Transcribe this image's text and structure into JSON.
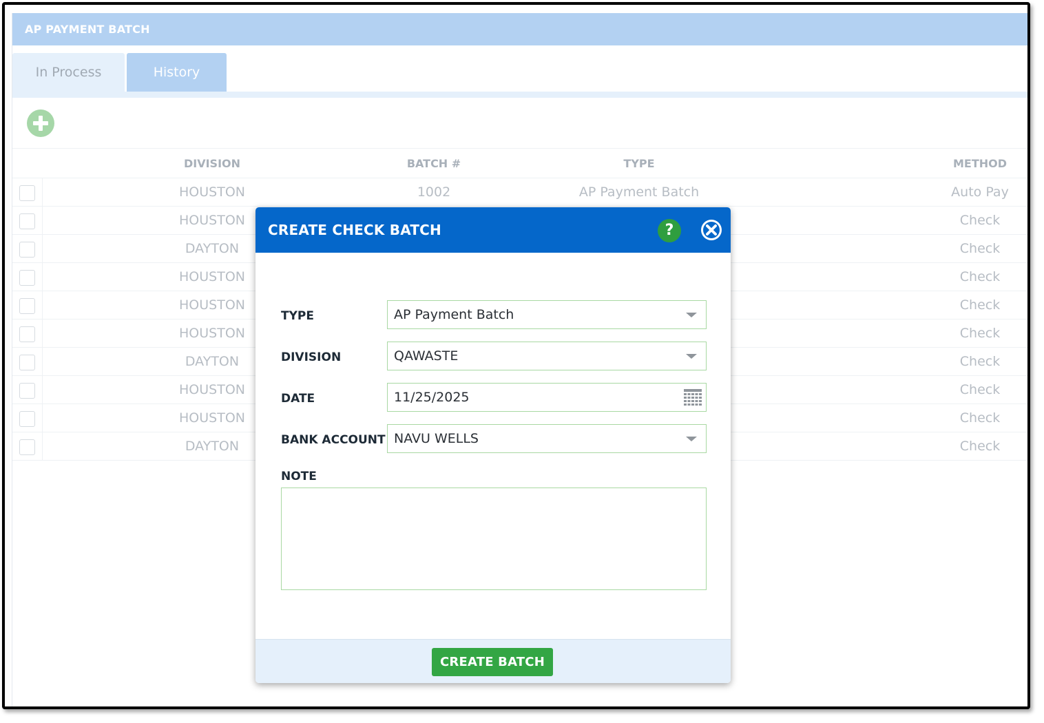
{
  "window": {
    "title": "AP PAYMENT BATCH"
  },
  "tabs": [
    {
      "label": "In Process",
      "active": true
    },
    {
      "label": "History",
      "active": false
    }
  ],
  "toolbar": {
    "add_icon": "plus-circle-icon"
  },
  "table": {
    "columns": [
      "DIVISION",
      "BATCH #",
      "TYPE",
      "METHOD"
    ],
    "rows": [
      {
        "division": "HOUSTON",
        "batch": "1002",
        "type": "AP Payment Batch",
        "method": "Auto Pay"
      },
      {
        "division": "HOUSTON",
        "batch": "",
        "type": "",
        "method": "Check"
      },
      {
        "division": "DAYTON",
        "batch": "",
        "type": "",
        "method": "Check"
      },
      {
        "division": "HOUSTON",
        "batch": "",
        "type": "",
        "method": "Check"
      },
      {
        "division": "HOUSTON",
        "batch": "",
        "type": "",
        "method": "Check"
      },
      {
        "division": "HOUSTON",
        "batch": "",
        "type": "",
        "method": "Check"
      },
      {
        "division": "DAYTON",
        "batch": "",
        "type": "",
        "method": "Check"
      },
      {
        "division": "HOUSTON",
        "batch": "",
        "type": "",
        "method": "Check"
      },
      {
        "division": "HOUSTON",
        "batch": "",
        "type": "",
        "method": "Check"
      },
      {
        "division": "DAYTON",
        "batch": "",
        "type": "",
        "method": "Check"
      }
    ]
  },
  "modal": {
    "title": "CREATE CHECK BATCH",
    "help_label": "?",
    "fields": {
      "type": {
        "label": "TYPE",
        "value": "AP Payment Batch"
      },
      "division": {
        "label": "DIVISION",
        "value": "QAWASTE"
      },
      "date": {
        "label": "DATE",
        "value": "11/25/2025"
      },
      "bank_account": {
        "label": "BANK ACCOUNT",
        "value": "NAVU WELLS"
      },
      "note": {
        "label": "NOTE",
        "value": ""
      }
    },
    "create_button": "CREATE BATCH"
  },
  "colors": {
    "header_bg": "#b3d1f2",
    "modal_header": "#0567ca",
    "help_green": "#2f9e3f",
    "create_green": "#33a644",
    "field_border": "#a8d8a2"
  }
}
